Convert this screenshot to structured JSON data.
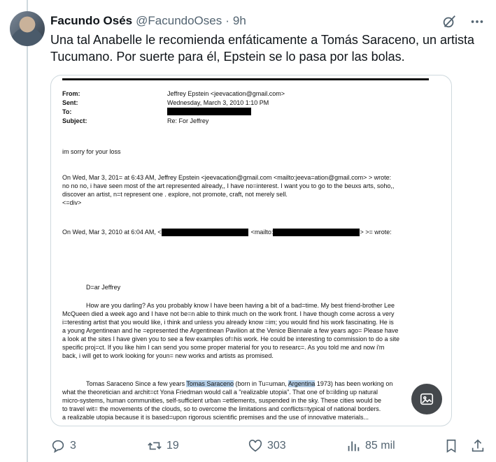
{
  "tweet": {
    "display_name": "Facundo Osés",
    "handle": "@FacundoOses",
    "separator": "·",
    "time": "9h",
    "text": "Una tal Anabelle le recomienda enfáticamente a Tomás Saraceno, un artista Tucumano. Por suerte para él, Epstein se lo pasa por las bolas."
  },
  "icons": {
    "grok": "grok-icon",
    "more": "more-icon",
    "reply": "reply-icon",
    "retweet": "retweet-icon",
    "like": "like-icon",
    "views": "views-icon",
    "bookmark": "bookmark-icon",
    "share": "share-icon",
    "media_action": "image-edit-icon"
  },
  "document": {
    "from_label": "From:",
    "from_value": "Jeffrey Epstein <jeevacation@gmail.com>",
    "sent_label": "Sent:",
    "sent_value": "Wednesday, March 3, 2010 1:10 PM",
    "to_label": "To:",
    "subject_label": "Subject:",
    "subject_value": "Re: For Jeffrey",
    "p1": "im sorry for your loss",
    "p2_l1": "On Wed, Mar 3, 201= at 6:43 AM, Jeffrey Epstein <jeevacation@gmail.com <mailto:jeeva=ation@gmail.com> > wrote:",
    "p2_l2": "no no no,  i have seen most of the art represented already,,  I have no=interest. I want you to go to the beuxs arts, soho,,",
    "p2_l3": "discover an artist, n=t represent one . explore, not promote, craft, not merely sell.",
    "p2_l4": "<=div>",
    "p3_a": "On Wed, Mar 3, 2010 at 6:04 AM, <",
    "p3_b": "<mailto:",
    "p3_c": "> >= wrote:",
    "greeting": "D=ar Jeffrey",
    "b1_l1": "How are you darling? As you probably know I have been having a bit of a bad=time. My best friend-brother Lee",
    "b1_l2": "McQueen died a week ago and I have not be=n able to think much on the work front. I have though come across a very",
    "b1_l3": "i=teresting artist that you would like, i think and unless you already know =im; you would find his work fascinating. He is",
    "b1_l4": "a young Argentinean and he =epresented the Argentinean Pavilion at the Venice Biennale a few years ago= Please have",
    "b1_l5": "a look at the sites I have given you to see a few examples of=his work. He could be interesting to commission to do a site",
    "b1_l6": "specific proj=ct. If you like him I can send you some proper material for you to researc=. As you told me and now i'm",
    "b1_l7": "back, i will get to work looking for youn= new works and artists as promised.",
    "b2_l1_a": "Tomas Saraceno Since a few years",
    "b2_l1_hl1": "Tomas Saraceno",
    "b2_l1_b": "(born in Tu=uman,",
    "b2_l1_hl2": "Argentina",
    "b2_l1_c": "1973) has been working on",
    "b2_l2": "what the theoretician and archit=ct Yona Friedman would call a \"realizable utopia\". That one of b=ilding up natural",
    "b2_l3": "micro-systems, human communities, self-sufficient urban =ettlements, suspended in the sky. These cities would be",
    "b2_l4": "to travel wit= the movements of the clouds, so to overcome the limitations and conflicts=typical of national borders.",
    "b2_l5": "a realizable utopia because it is based=upon rigorous scientific premises and the use of innovative materials..."
  },
  "actions": {
    "replies": "3",
    "retweets": "19",
    "likes": "303",
    "views": "85 mil"
  }
}
